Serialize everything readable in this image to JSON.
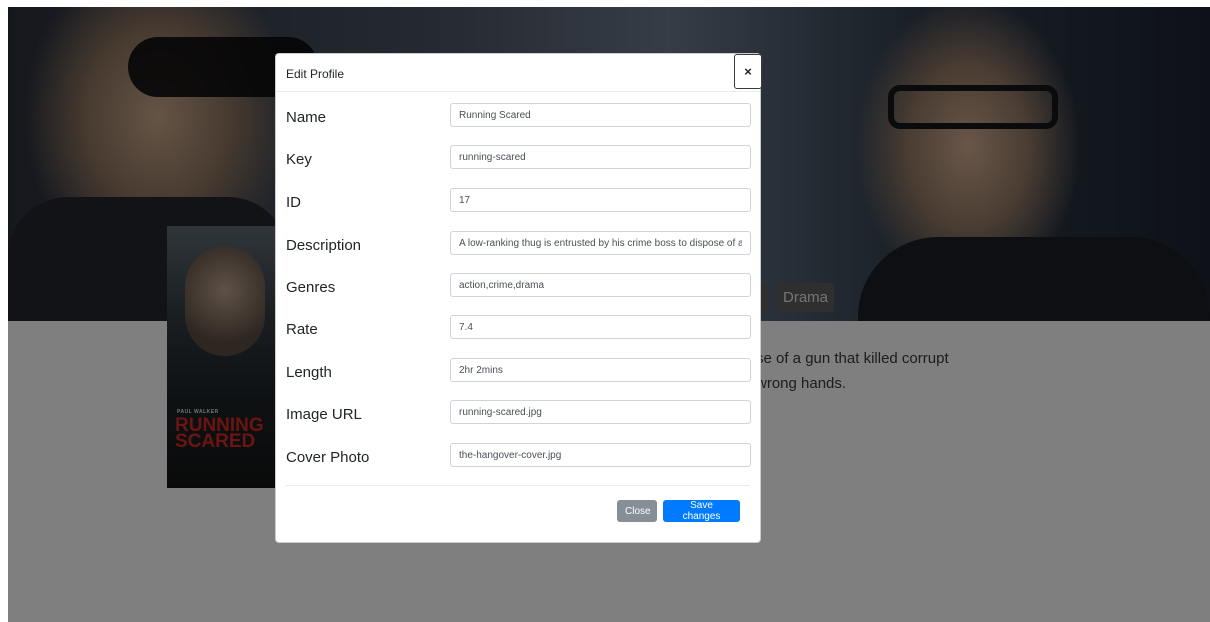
{
  "background": {
    "genres": [
      "Drama"
    ],
    "description_lines": [
      "se of a gun that killed corrupt",
      "wrong hands."
    ],
    "poster": {
      "credit": "PAUL WALKER",
      "title": "RUNNING SCARED"
    }
  },
  "modal": {
    "title": "Edit Profile",
    "close_glyph": "×",
    "fields": [
      {
        "label": "Name",
        "value": "Running Scared"
      },
      {
        "label": "Key",
        "value": "running-scared"
      },
      {
        "label": "ID",
        "value": "17"
      },
      {
        "label": "Description",
        "value": "A low-ranking thug is entrusted by his crime boss to dispose of a gun that killed corrupt cops, but things get out of control when the gun ends up in wrong hands."
      },
      {
        "label": "Genres",
        "value": "action,crime,drama"
      },
      {
        "label": "Rate",
        "value": "7.4"
      },
      {
        "label": "Length",
        "value": "2hr 2mins"
      },
      {
        "label": "Image URL",
        "value": "running-scared.jpg"
      },
      {
        "label": "Cover Photo",
        "value": "the-hangover-cover.jpg"
      }
    ],
    "close_label": "Close",
    "save_label": "Save changes"
  },
  "colors": {
    "primary": "#007bff",
    "secondary": "#868e96",
    "backdrop": "#000000"
  }
}
